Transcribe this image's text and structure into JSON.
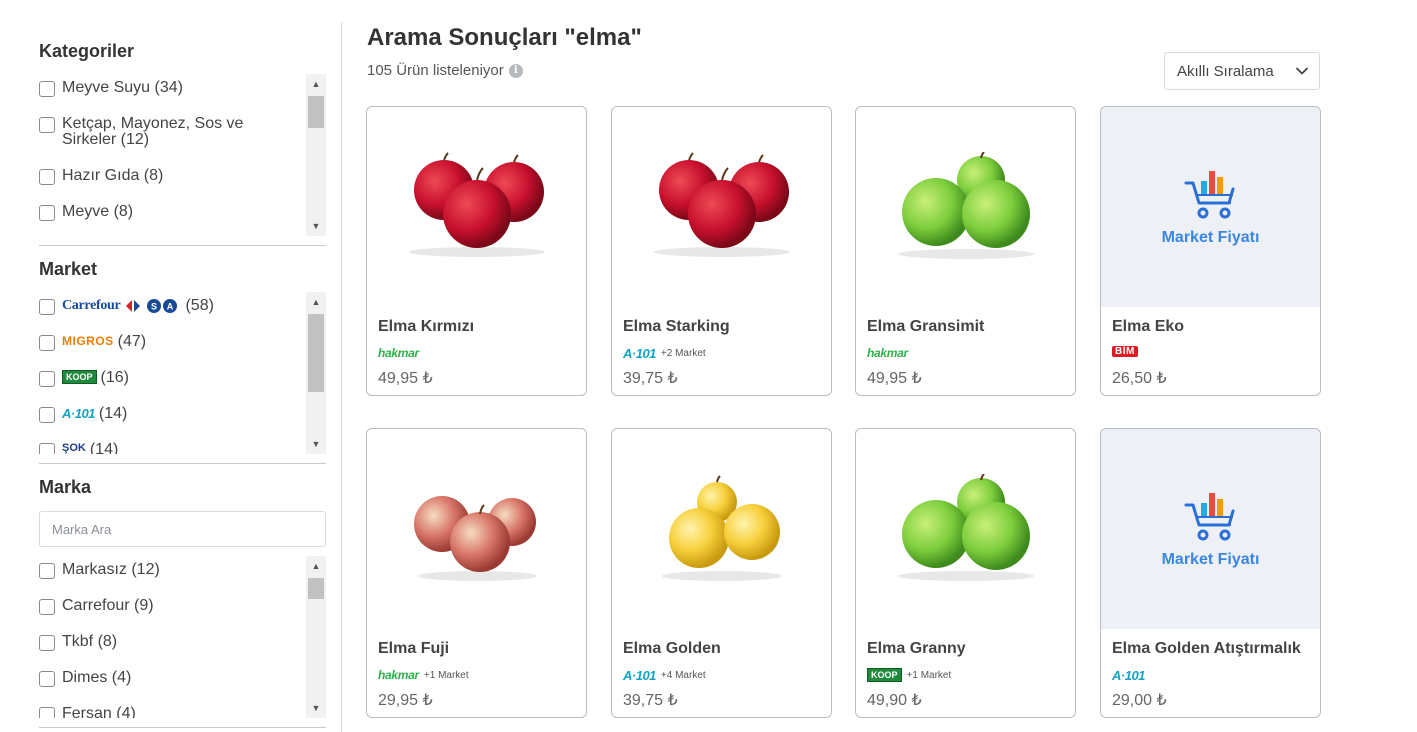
{
  "sidebar": {
    "categories": {
      "title": "Kategoriler",
      "items": [
        {
          "label": "Meyve Suyu (34)"
        },
        {
          "label": "Ketçap, Mayonez, Sos ve Sirkeler (12)"
        },
        {
          "label": "Hazır Gıda (8)"
        },
        {
          "label": "Meyve (8)"
        }
      ]
    },
    "market": {
      "title": "Market",
      "items": [
        {
          "logo": "Carrefour",
          "count": "(58)"
        },
        {
          "logo": "MIGROS",
          "count": "(47)"
        },
        {
          "logo": "KOOP",
          "count": "(16)"
        },
        {
          "logo": "A·101",
          "count": "(14)"
        },
        {
          "logo": "ŞOK",
          "count": "(14)"
        }
      ]
    },
    "brand": {
      "title": "Marka",
      "search_placeholder": "Marka Ara",
      "items": [
        {
          "label": "Markasız (12)"
        },
        {
          "label": "Carrefour (9)"
        },
        {
          "label": "Tkbf (8)"
        },
        {
          "label": "Dimes (4)"
        },
        {
          "label": "Fersan (4)"
        }
      ]
    }
  },
  "main": {
    "title": "Arama Sonuçları \"elma\"",
    "result_count": "105 Ürün listeleniyor",
    "info_icon": "i",
    "sort": {
      "selected": "Akıllı Sıralama"
    },
    "placeholder_text": "Market Fiyatı",
    "products": [
      {
        "name": "Elma Kırmızı",
        "market": "hakmar",
        "extra": "",
        "price": "49,95 ₺",
        "image": "red-apple"
      },
      {
        "name": "Elma Starking",
        "market": "A·101",
        "extra": "+2 Market",
        "price": "39,75 ₺",
        "image": "red-apple"
      },
      {
        "name": "Elma Gransimit",
        "market": "hakmar",
        "extra": "",
        "price": "49,95 ₺",
        "image": "green-apple"
      },
      {
        "name": "Elma Eko",
        "market": "BİM",
        "extra": "",
        "price": "26,50 ₺",
        "image": "placeholder"
      },
      {
        "name": "Elma Fuji",
        "market": "hakmar",
        "extra": "+1 Market",
        "price": "29,95 ₺",
        "image": "fuji-apple"
      },
      {
        "name": "Elma Golden",
        "market": "A·101",
        "extra": "+4 Market",
        "price": "39,75 ₺",
        "image": "yellow-apple"
      },
      {
        "name": "Elma Granny",
        "market": "KOOP",
        "extra": "+1 Market",
        "price": "49,90 ₺",
        "image": "green-apple"
      },
      {
        "name": "Elma Golden Atıştırmalık",
        "market": "A·101",
        "extra": "",
        "price": "29,00 ₺",
        "image": "placeholder"
      }
    ]
  },
  "colors": {
    "red_apple": "#c8102e",
    "green_apple": "#7ccd3c",
    "yellow_apple": "#f7d03c",
    "placeholder_bg": "#edf0f4",
    "market_fiyati_blue": "#3b86e0"
  }
}
